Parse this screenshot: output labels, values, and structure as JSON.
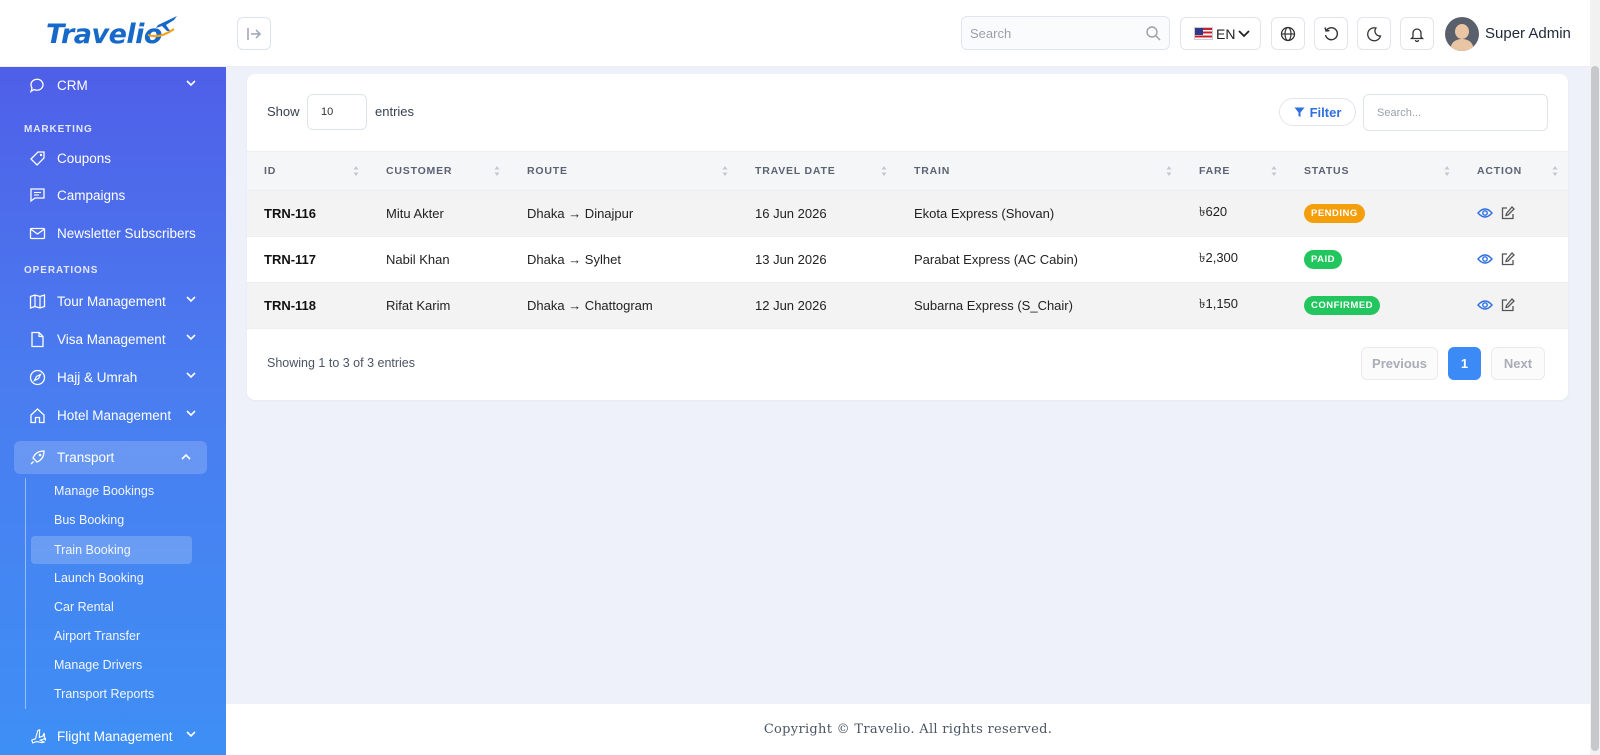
{
  "header": {
    "logo_text": "Travelio",
    "search_placeholder": "Search",
    "language": "EN",
    "user_name": "Super Admin"
  },
  "sidebar": {
    "crm": "CRM",
    "marketing_label": "MARKETING",
    "coupons": "Coupons",
    "campaigns": "Campaigns",
    "newsletter": "Newsletter Subscribers",
    "operations_label": "OPERATIONS",
    "tour": "Tour Management",
    "visa": "Visa Management",
    "hajj": "Hajj & Umrah",
    "hotel": "Hotel Management",
    "transport": "Transport",
    "transport_items": [
      "Manage Bookings",
      "Bus Booking",
      "Train Booking",
      "Launch Booking",
      "Car Rental",
      "Airport Transfer",
      "Manage Drivers",
      "Transport Reports"
    ],
    "flight": "Flight Management"
  },
  "table_controls": {
    "show_label": "Show",
    "entries_value": "10",
    "entries_label": "entries",
    "filter_label": "Filter",
    "search_placeholder": "Search..."
  },
  "table": {
    "headers": [
      "ID",
      "CUSTOMER",
      "ROUTE",
      "TRAVEL DATE",
      "TRAIN",
      "FARE",
      "STATUS",
      "ACTION"
    ],
    "rows": [
      {
        "id": "TRN-116",
        "customer": "Mitu Akter",
        "route": "Dhaka → Dinajpur",
        "date": "16 Jun 2026",
        "train": "Ekota Express (Shovan)",
        "fare": "৳620",
        "status": "PENDING"
      },
      {
        "id": "TRN-117",
        "customer": "Nabil Khan",
        "route": "Dhaka → Sylhet",
        "date": "13 Jun 2026",
        "train": "Parabat Express (AC Cabin)",
        "fare": "৳2,300",
        "status": "PAID"
      },
      {
        "id": "TRN-118",
        "customer": "Rifat Karim",
        "route": "Dhaka → Chattogram",
        "date": "12 Jun 2026",
        "train": "Subarna Express (S_Chair)",
        "fare": "৳1,150",
        "status": "CONFIRMED"
      }
    ]
  },
  "pagination": {
    "showing": "Showing 1 to 3 of 3 entries",
    "previous": "Previous",
    "current_page": "1",
    "next": "Next"
  },
  "footer": {
    "copyright": "Copyright © Travelio. All rights reserved."
  },
  "colors": {
    "accent": "#3b8af6",
    "pending": "#f59e0b",
    "success": "#22c55e",
    "sidebar_top": "#4f5fe8",
    "sidebar_bottom": "#3e8ff5"
  }
}
